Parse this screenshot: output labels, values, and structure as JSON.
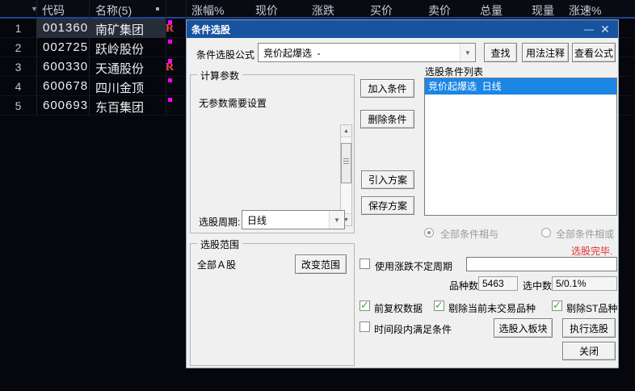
{
  "colors": {
    "titlebar_blue": "#1853a0",
    "selection_blue": "#1b86e4",
    "status_red": "#dd3333",
    "marker_magenta": "#ff00ff",
    "r_red": "#ff4343",
    "check_green": "#2db52d"
  },
  "table": {
    "sort_icon": "▼",
    "headers": {
      "code": "代码",
      "name": "名称(5)",
      "pct": "涨幅%",
      "price": "现价",
      "change": "涨跌",
      "buy": "买价",
      "sell": "卖价",
      "volume": "总量",
      "cur_volume": "现量",
      "speed": "涨速%"
    },
    "r_badge": "R",
    "rows": [
      {
        "num": "1",
        "code": "001360",
        "name": "南矿集团"
      },
      {
        "num": "2",
        "code": "002725",
        "name": "跃岭股份"
      },
      {
        "num": "3",
        "code": "600330",
        "name": "天通股份"
      },
      {
        "num": "4",
        "code": "600678",
        "name": "四川金顶"
      },
      {
        "num": "5",
        "code": "600693",
        "name": "东百集团"
      }
    ]
  },
  "dialog": {
    "title": "条件选股",
    "minimize_icon": "—",
    "close_icon": "✕",
    "formula_label": "条件选股公式",
    "formula_value": "竞价起爆选  -",
    "combo_arrow": "▼",
    "find_btn": "查找",
    "usage_btn": "用法注释",
    "view_formula_btn": "查看公式",
    "params_group": "计算参数",
    "params_empty_text": "无参数需要设置",
    "scroll_up_icon": "▲",
    "scroll_down_icon": "▼",
    "period_label": "选股周期:",
    "period_value": "日线",
    "range_group": "选股范围",
    "range_value": "全部Ａ股",
    "change_range_btn": "改变范围",
    "add_condition_btn": "加入条件",
    "del_condition_btn": "删除条件",
    "import_plan_btn": "引入方案",
    "save_plan_btn": "保存方案",
    "list_label": "选股条件列表",
    "list_item": "竞价起爆选  日线",
    "radio_and": "全部条件相与",
    "radio_or": "全部条件相或",
    "status_done": "选股完毕.",
    "cb_variable_period": "使用涨跌不定周期",
    "period_input_value": "",
    "count_label": "品种数",
    "count_value": "5463",
    "selected_label": "选中数",
    "selected_value": "5/0.1%",
    "cb_forward_adjust": "前复权数据",
    "cb_exclude_untraded": "剔除当前未交易品种",
    "cb_exclude_st": "剔除ST品种",
    "cb_time_range": "时间段内满足条件",
    "to_block_btn": "选股入板块",
    "execute_btn": "执行选股",
    "close_btn": "关闭"
  }
}
